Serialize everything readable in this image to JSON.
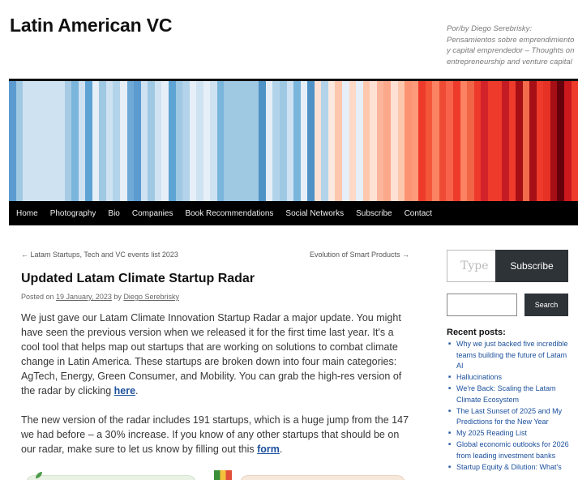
{
  "site": {
    "title": "Latin American VC",
    "description": "Por/by Diego Serebrisky: Pensamientos sobre emprendimiento y capital emprendedor – Thoughts on entrepreneurship and venture capital"
  },
  "nav": {
    "items": [
      "Home",
      "Photography",
      "Bio",
      "Companies",
      "Book Recommendations",
      "Social Networks",
      "Subscribe",
      "Contact"
    ]
  },
  "stripe_colors": [
    "#5b9bd0",
    "#9fc8e3",
    "#cfe2f2",
    "#cfe2f2",
    "#cfe2f2",
    "#cfe2f2",
    "#cfe2f2",
    "#cfe2f2",
    "#a7cbe4",
    "#7ab5dc",
    "#cfe2f2",
    "#5da3d3",
    "#e6eff8",
    "#9fc8e3",
    "#cfe2f2",
    "#b2d3ea",
    "#e6eff8",
    "#6faad7",
    "#5b9bd0",
    "#cfe2f2",
    "#9fc8e3",
    "#cfe2f2",
    "#e6eff8",
    "#5da3d3",
    "#9fc8e3",
    "#b2d3ea",
    "#e6eff8",
    "#cfe2f2",
    "#e6eff8",
    "#cfe2f2",
    "#7ab5dc",
    "#9fc8e3",
    "#9fc8e3",
    "#9fc8e3",
    "#9fc8e3",
    "#9fc8e3",
    "#4f92c6",
    "#e6eff8",
    "#b2d3ea",
    "#9fc8e3",
    "#cfe2f2",
    "#7ab5dc",
    "#e6eff8",
    "#4f92c6",
    "#fde1d5",
    "#b2d3ea",
    "#fbe8df",
    "#fcc7ad",
    "#e6eff8",
    "#fdd9c6",
    "#e6eff8",
    "#fcc7ad",
    "#fde1d5",
    "#fbb59a",
    "#fca88a",
    "#fde1d5",
    "#fcc7ad",
    "#fc9372",
    "#fc9a7b",
    "#ee3a2b",
    "#f4563a",
    "#fb8262",
    "#ef4a33",
    "#f7624a",
    "#ee3a2b",
    "#fb8262",
    "#f06545",
    "#ee3a2b",
    "#d3232a",
    "#ee3a2b",
    "#ee3a2b",
    "#c41c25",
    "#ee3a2b",
    "#a50f15",
    "#f26b4b",
    "#a50f15",
    "#ee3a2b",
    "#e63226",
    "#a50f15",
    "#67000d",
    "#cb181d",
    "#ee3a2b"
  ],
  "post_nav": {
    "prev": "← Latam Startups, Tech and VC events list 2023",
    "next": "Evolution of Smart Products →"
  },
  "post": {
    "title": "Updated Latam Climate Startup Radar",
    "meta_posted_on": "Posted on ",
    "meta_date": "19 January, 2023",
    "meta_by": " by ",
    "meta_author": "Diego Serebrisky",
    "p1_text": "We just gave our Latam Climate Innovation Startup Radar a major update. You might have seen the previous version when we released it for the first time last year. It's a cool tool that helps map out startups that are working on solutions to combat climate change in Latin America. These startups are broken down into four main categories: AgTech, Energy, Green Consumer, and Mobility. You can grab the high-res version of the radar by clicking ",
    "p1_link": "here",
    "p1_end": ".",
    "p2_text": "The new version of the radar includes 191 startups, which is a huge jump from the 147 we had before – a 30% increase. If you know of any other startups that should be on our radar, make sure to let us know by filling out this ",
    "p2_link": "form",
    "p2_end": "."
  },
  "sidebar": {
    "subscribe_placeholder": "Type",
    "subscribe_button": "Subscribe",
    "search_button": "Search",
    "recent_heading": "Recent posts:",
    "recent_posts": [
      "Why we just backed five incredible teams building the future of Latam AI",
      "Hallucinations",
      "We're Back: Scaling the Latam Climate Ecosystem",
      "The Last Sunset of 2025 and My Predictions for the New Year",
      "My 2025 Reading List",
      "Global economic outlooks for 2026 from leading investment banks",
      "Startup Equity & Dilution: What's"
    ]
  }
}
